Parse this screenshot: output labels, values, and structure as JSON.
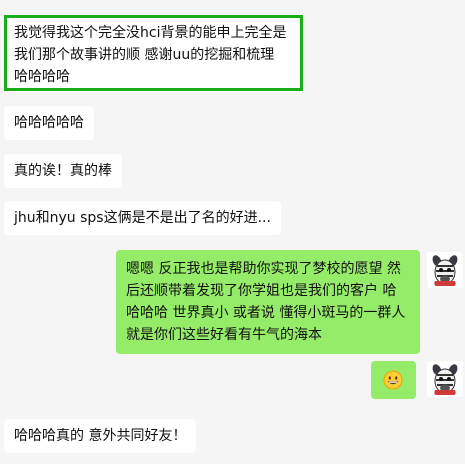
{
  "messages": [
    {
      "id": "m1",
      "side": "received",
      "text": "我觉得我这个完全没hci背景的能申上完全是我们那个故事讲的顺 感谢uu的挖掘和梳理 哈哈哈哈",
      "highlighted": true
    },
    {
      "id": "m2",
      "side": "received",
      "text": "哈哈哈哈哈"
    },
    {
      "id": "m3",
      "side": "received",
      "text": "真的诶！真的棒"
    },
    {
      "id": "m4",
      "side": "received",
      "text": "jhu和nyu sps这俩是不是出了名的好进..."
    },
    {
      "id": "m5",
      "side": "sent",
      "text": "嗯嗯 反正我也是帮助你实现了梦校的愿望 然后还顺带着发现了你学姐也是我们的客户 哈哈哈哈  世界真小 或者说 懂得小斑马的一群人就是你们这些好看有牛气的海本",
      "avatar": "zebra-avatar"
    },
    {
      "id": "m6",
      "side": "sent",
      "emoji": "grinning-face-emoji",
      "avatar": "zebra-avatar"
    },
    {
      "id": "m7",
      "side": "received",
      "text": "哈哈哈真的 意外共同好友！"
    }
  ],
  "colors": {
    "background": "#f5f5f5",
    "received_bubble": "#ffffff",
    "sent_bubble": "#95ec69",
    "highlight_border": "#1aad19"
  }
}
